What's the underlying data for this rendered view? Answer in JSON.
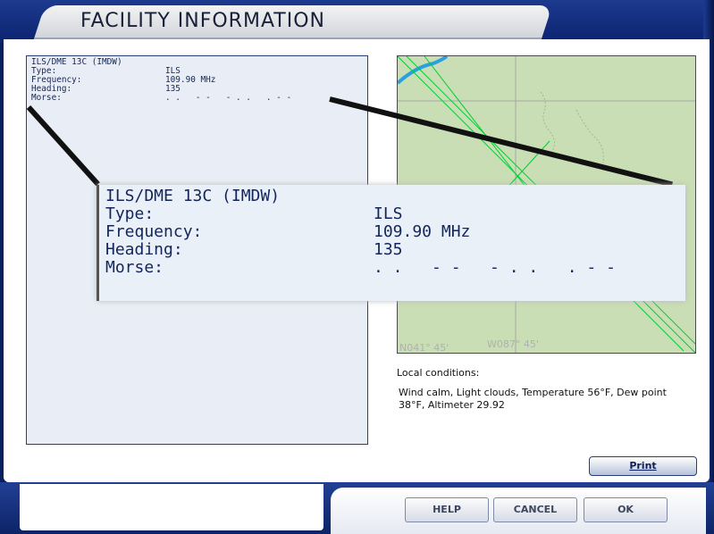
{
  "window": {
    "title": "FACILITY INFORMATION"
  },
  "facility": {
    "name": "ILS/DME 13C (IMDW)",
    "rows": [
      {
        "label": "Type:",
        "value": "ILS"
      },
      {
        "label": "Frequency:",
        "value": "109.90 MHz"
      },
      {
        "label": "Heading:",
        "value": "135"
      },
      {
        "label": "Morse:",
        "value": ". .   - -   - . .   . - -"
      }
    ]
  },
  "map": {
    "lat_label": "N041° 45'",
    "lon_label": "W087° 45'",
    "colors": {
      "land": "#c9deb4",
      "water": "#2aa0e0",
      "localizer": "#00cc33",
      "grid": "#a8a8a8"
    }
  },
  "conditions": {
    "label": "Local conditions:",
    "text": "Wind calm, Light clouds, Temperature 56°F, Dew point 38°F, Altimeter 29.92"
  },
  "buttons": {
    "print": "Print",
    "help": "HELP",
    "cancel": "CANCEL",
    "ok": "OK"
  }
}
